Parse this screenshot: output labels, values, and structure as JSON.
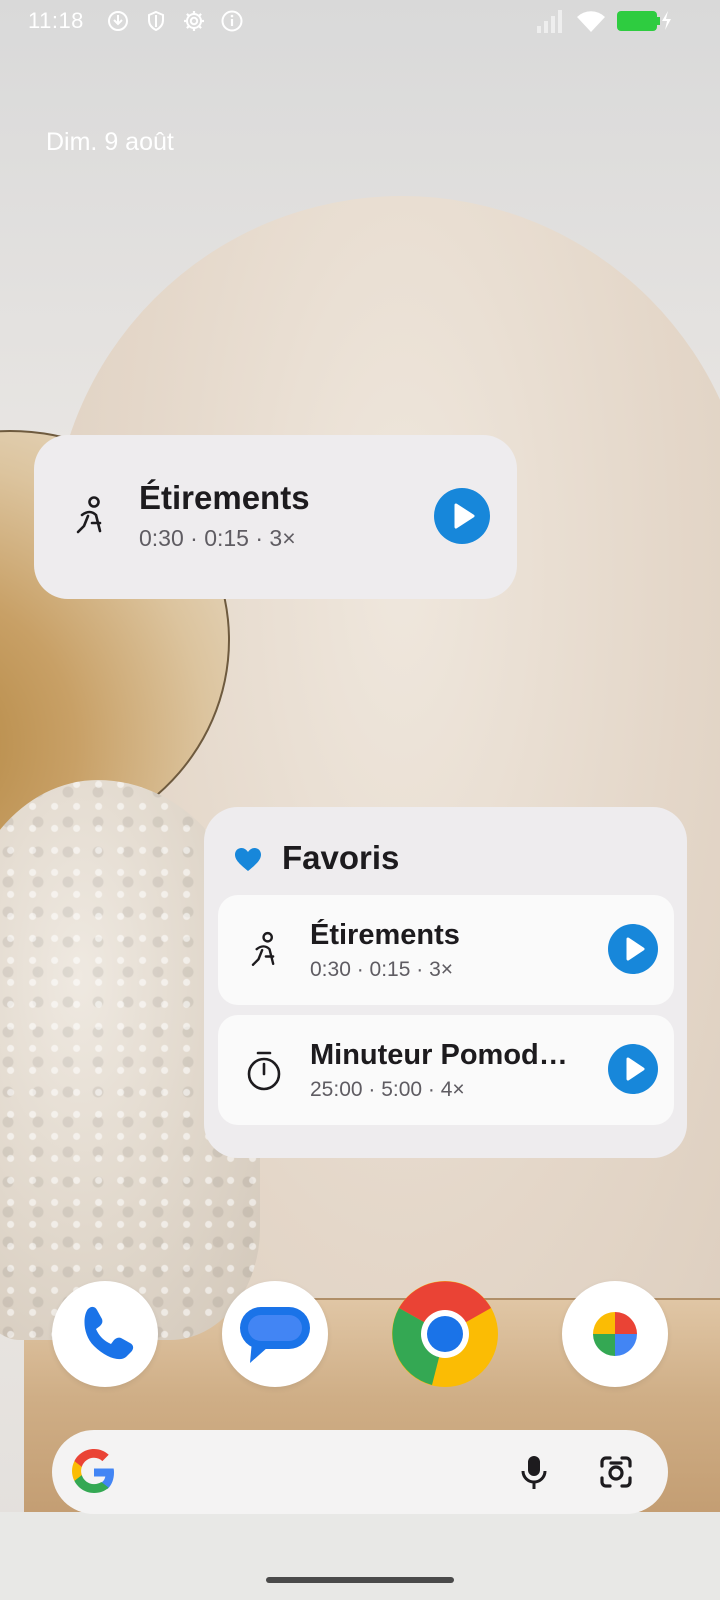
{
  "status_bar": {
    "time": "11:18",
    "left_icons": [
      "download-icon",
      "shield-icon",
      "settings-gear-icon",
      "info-icon"
    ],
    "right_icons": [
      "signal-icon",
      "wifi-icon",
      "battery-charging-icon"
    ],
    "battery_color": "#2ecc40"
  },
  "home": {
    "date": "Dim. 9 août"
  },
  "widget_single": {
    "icon": "stretching-person-icon",
    "title": "Étirements",
    "subtitle": "0:30 · 0:15 · 3×"
  },
  "widget_favorites": {
    "title": "Favoris",
    "heart_color": "#1787da",
    "items": [
      {
        "icon": "stretching-person-icon",
        "title": "Étirements",
        "subtitle": "0:30 · 0:15 · 3×"
      },
      {
        "icon": "stopwatch-icon",
        "title": "Minuteur Pomod…",
        "subtitle": "25:00 · 5:00 · 4×"
      }
    ]
  },
  "accent_color": "#1787da",
  "dock": {
    "apps": [
      "phone-app-icon",
      "messages-app-icon",
      "chrome-app-icon",
      "photos-app-icon"
    ]
  },
  "search_bar": {
    "placeholder": "",
    "icons": [
      "google-g-icon",
      "microphone-icon",
      "google-lens-icon"
    ]
  }
}
